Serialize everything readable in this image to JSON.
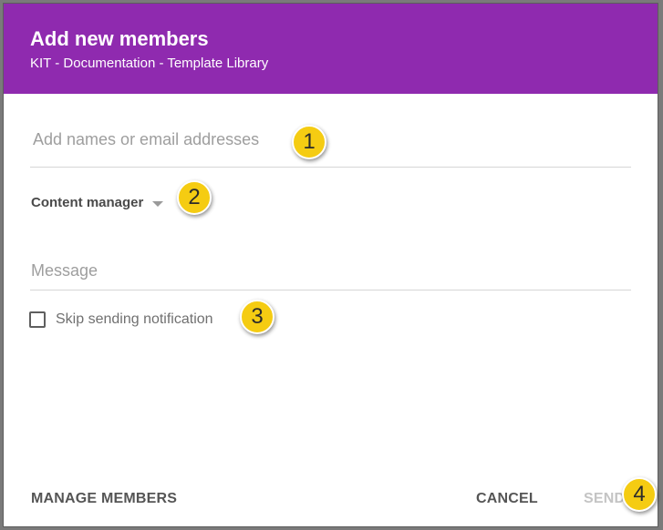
{
  "dialog": {
    "title": "Add new members",
    "subtitle": "KIT - Documentation - Template Library",
    "header_color": "#8f2aaf"
  },
  "form": {
    "names_placeholder": "Add names or email addresses",
    "names_value": "",
    "role": {
      "selected": "Content manager",
      "icon": "chevron-down-icon"
    },
    "message_placeholder": "Message",
    "message_value": "",
    "skip_notification": {
      "label": "Skip sending notification",
      "checked": false
    }
  },
  "footer": {
    "manage_label": "MANAGE MEMBERS",
    "cancel_label": "CANCEL",
    "send_label": "SEND",
    "send_enabled": false
  },
  "callouts": [
    "1",
    "2",
    "3",
    "4"
  ],
  "colors": {
    "callout": "#f5cc12",
    "accent": "#8f2aaf"
  }
}
